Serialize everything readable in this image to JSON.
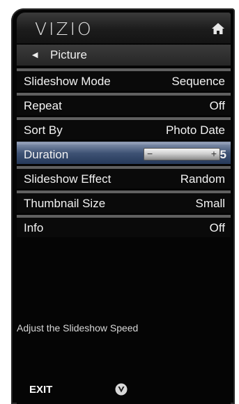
{
  "header": {
    "logo_text": "VIZIO",
    "home_icon": "home-icon"
  },
  "breadcrumb": {
    "back_icon": "left-arrow-icon",
    "label": "Picture"
  },
  "menu": [
    {
      "label": "Slideshow Mode",
      "value": "Sequence"
    },
    {
      "label": "Repeat",
      "value": "Off"
    },
    {
      "label": "Sort By",
      "value": "Photo Date"
    },
    {
      "label": "Duration",
      "value": "5",
      "selected": true
    },
    {
      "label": "Slideshow Effect",
      "value": "Random"
    },
    {
      "label": "Thumbnail Size",
      "value": "Small"
    },
    {
      "label": "Info",
      "value": "Off"
    }
  ],
  "slider": {
    "minus": "−",
    "plus": "+",
    "value": 5
  },
  "hint": "Adjust the Slideshow Speed",
  "footer": {
    "exit_label": "EXIT",
    "v_icon": "vizio-v-icon"
  },
  "colors": {
    "selected_row": "#3e5274",
    "panel_bg": "#050505",
    "divider": "#606060"
  }
}
